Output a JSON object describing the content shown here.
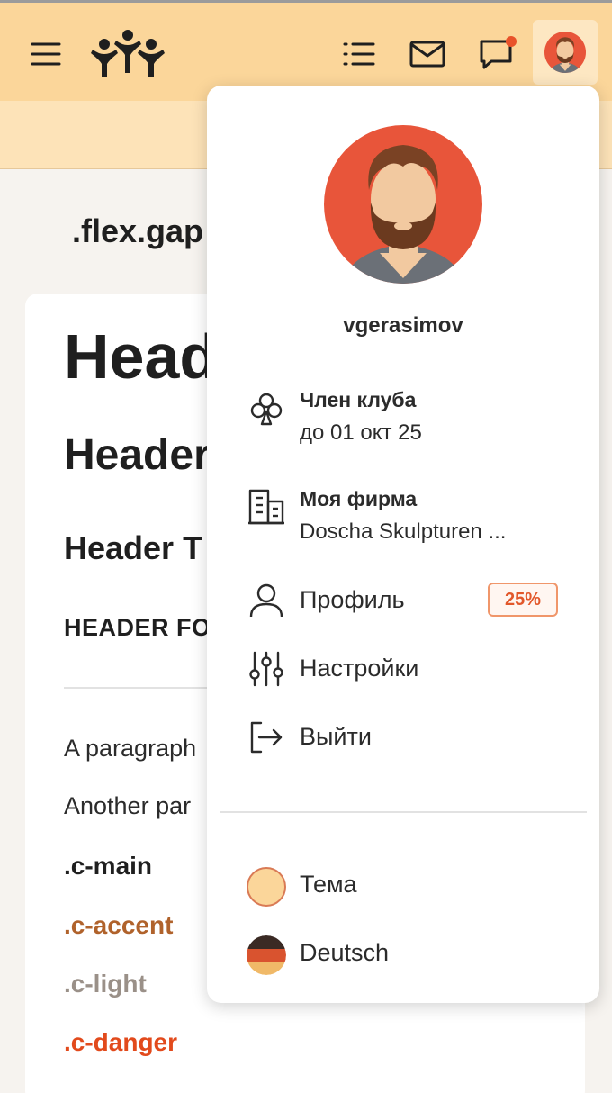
{
  "header": {
    "icons": [
      "menu-icon",
      "logo-people-icon",
      "list-icon",
      "mail-icon",
      "chat-icon",
      "avatar"
    ],
    "background_color": "#fbd69a",
    "notification_color": "#e8522a"
  },
  "page": {
    "heading": ".flex.gap"
  },
  "card": {
    "h1": "Head",
    "h2": "Header",
    "h3": "Header T",
    "h4": "HEADER FO",
    "p1": "A paragraph",
    "p2": "Another par",
    "c_main": ".c-main",
    "c_accent": ".c-accent",
    "c_light": ".c-light",
    "c_danger": ".c-danger"
  },
  "dropdown": {
    "username": "vgerasimov",
    "club": {
      "title": "Член клуба",
      "subtitle": "до 01 окт 25"
    },
    "firm": {
      "title": "Моя фирма",
      "subtitle": "Doscha Skulpturen ..."
    },
    "profile": {
      "label": "Профиль",
      "badge": "25%"
    },
    "settings": {
      "label": "Настройки"
    },
    "logout": {
      "label": "Выйти"
    },
    "theme": {
      "label": "Тема",
      "color": "#fbd69a"
    },
    "language": {
      "label": "Deutsch"
    }
  },
  "colors": {
    "accent": "#b0622b",
    "light": "#9a9088",
    "danger": "#e24a1c",
    "avatar_bg": "#e8553a"
  }
}
